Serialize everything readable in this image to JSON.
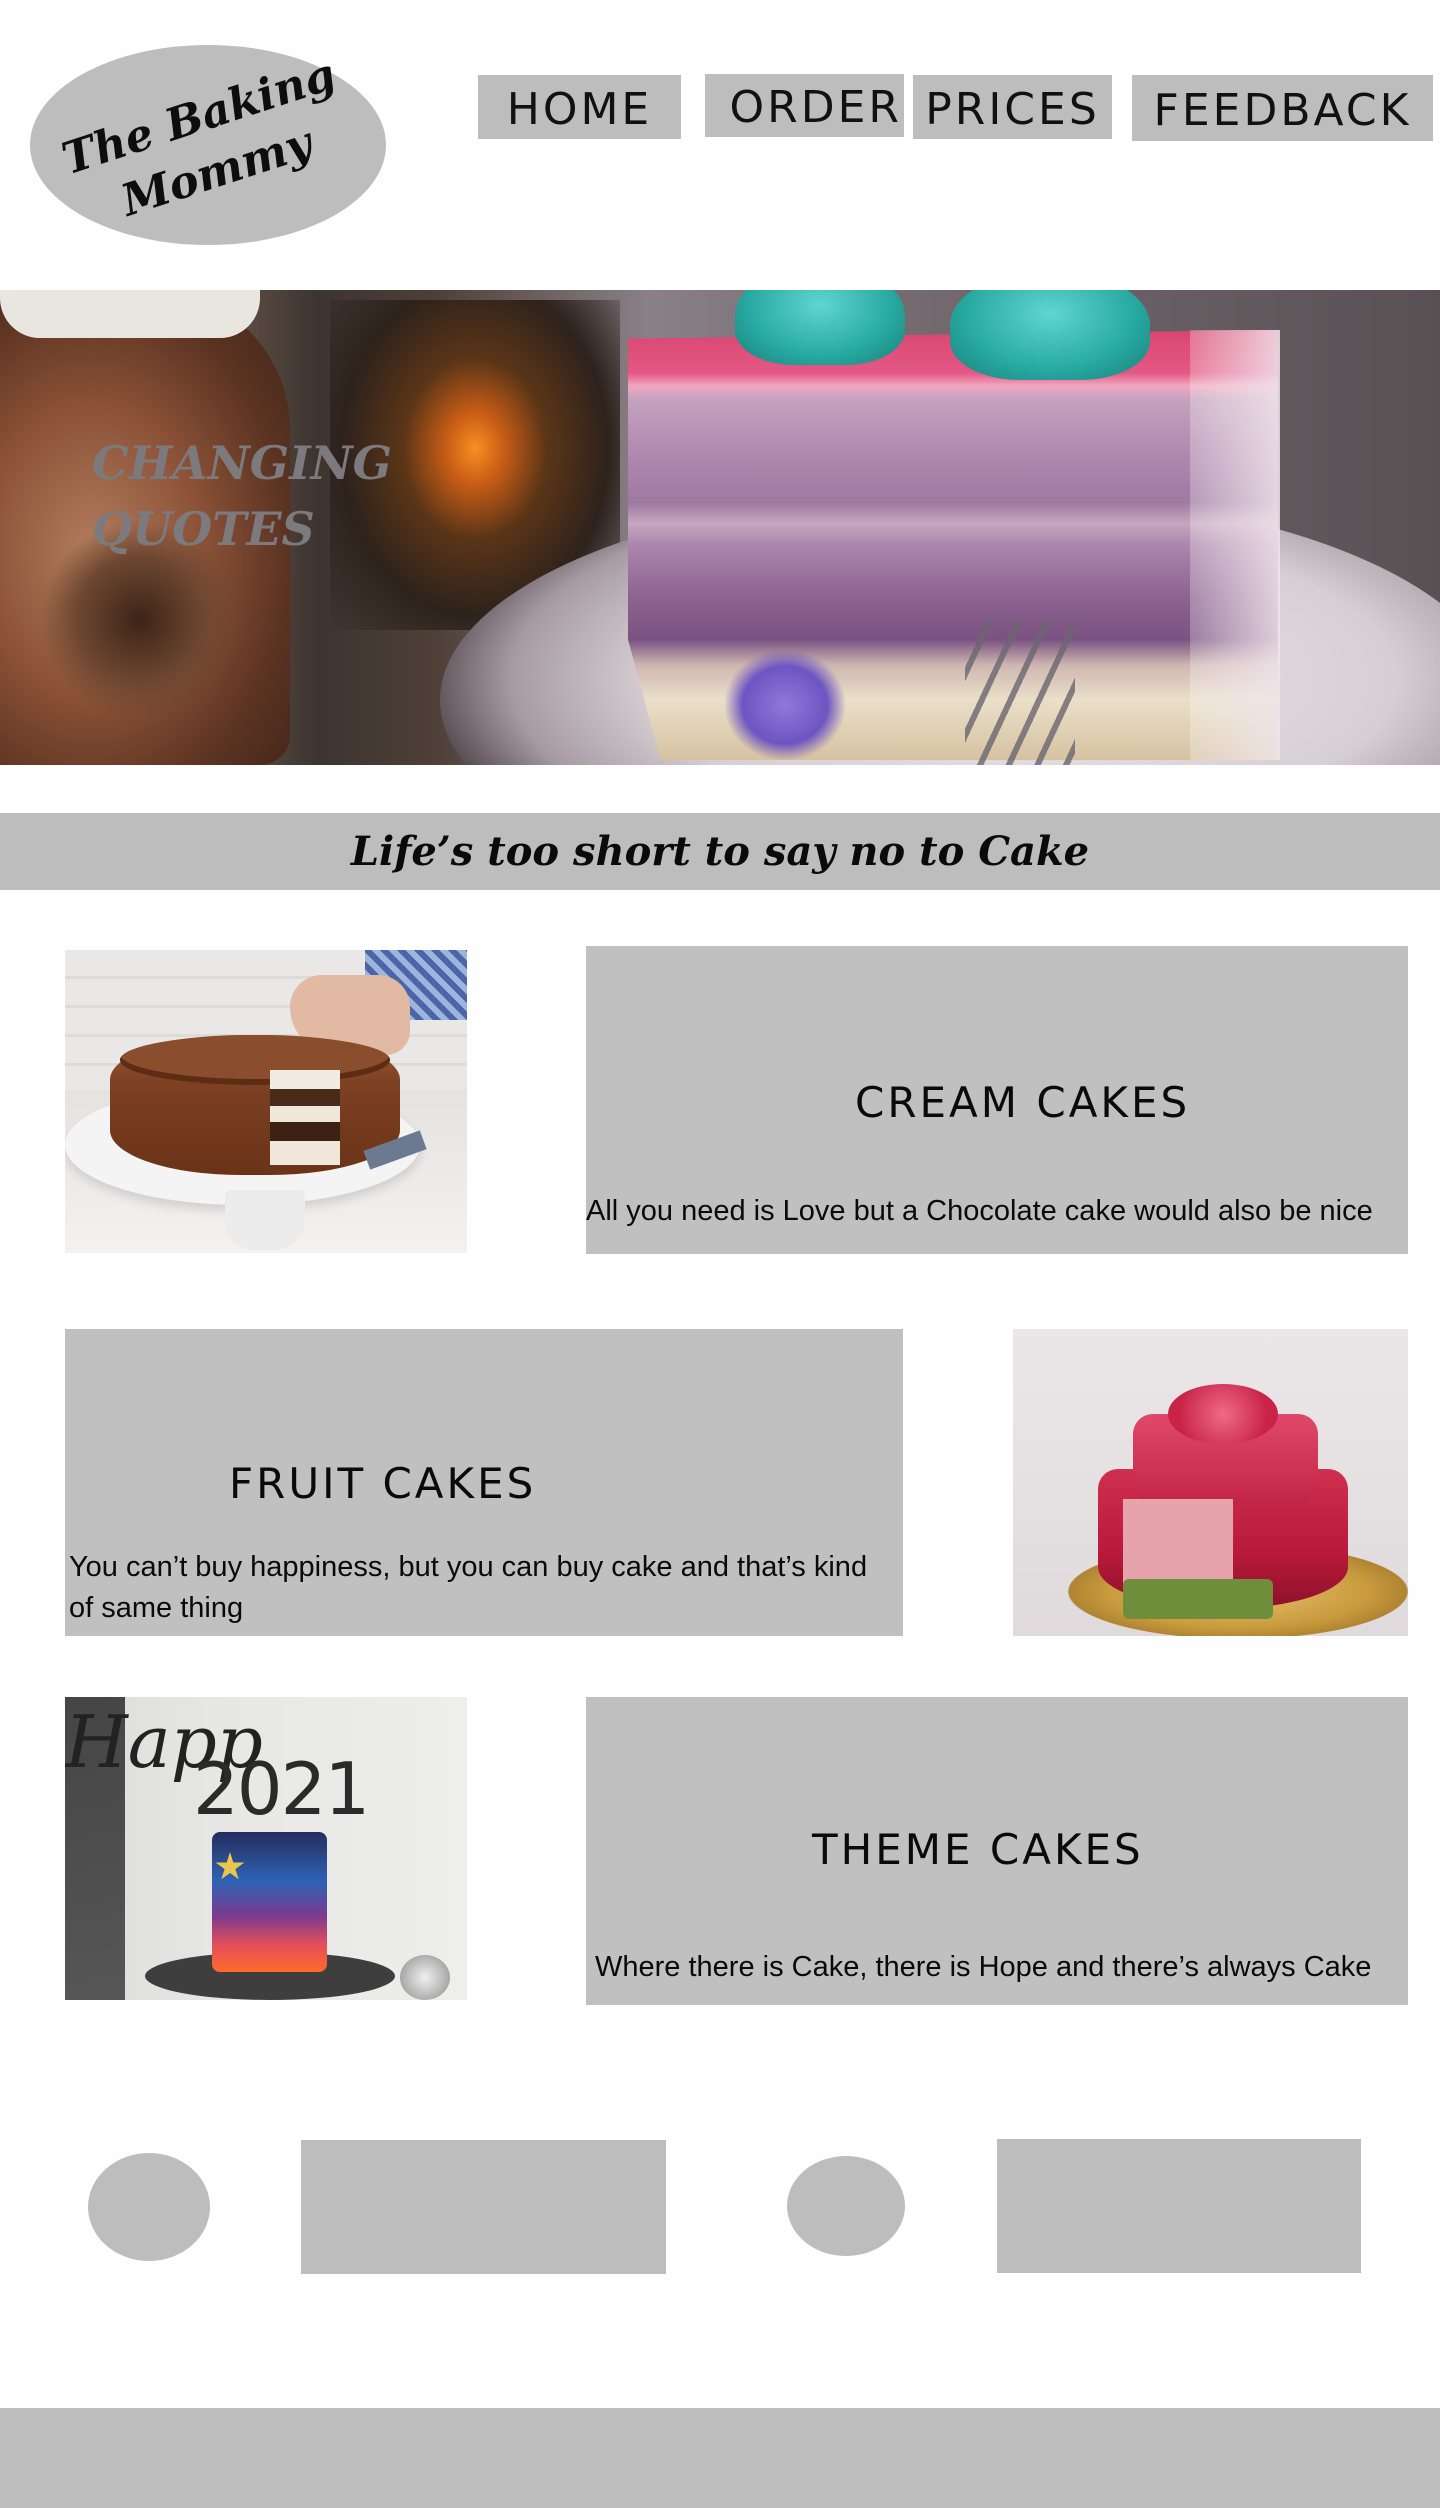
{
  "logo": {
    "line1": "The Baking",
    "line2": "Mommy"
  },
  "nav": {
    "home": "HOME",
    "order": "ORDER",
    "prices": "PRICES",
    "feedback": "FEEDBACK"
  },
  "hero": {
    "quote": "CHANGING\nQUOTES"
  },
  "tagline": "Life’s too short to say no to Cake",
  "sections": {
    "cream": {
      "title": "CREAM CAKES",
      "text": "All you need is Love but  a Chocolate cake would also be nice"
    },
    "fruit": {
      "title": "FRUIT CAKES",
      "text": "You can’t buy happiness, but you can buy cake and that’s kind of same thing"
    },
    "theme": {
      "title": "THEME CAKES",
      "text": "Where there is Cake, there is Hope and there’s always Cake",
      "cake_topper": "2021"
    }
  },
  "colors": {
    "panel_gray": "#c0c0c0",
    "nav_gray": "#bdbdbd",
    "text": "#0a0a0a"
  }
}
